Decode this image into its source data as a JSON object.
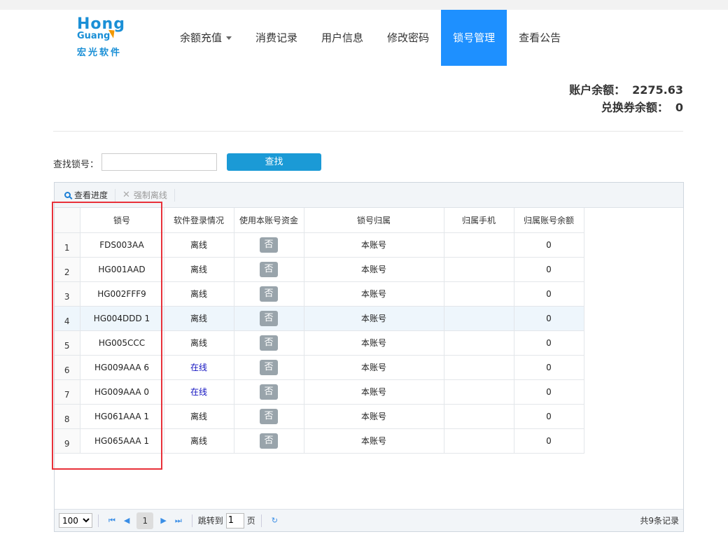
{
  "logo": {
    "en_top": "Hong",
    "en_bottom": "Guang",
    "cn": "宏光软件"
  },
  "nav": {
    "items": [
      {
        "label": "余额充值"
      },
      {
        "label": "消费记录"
      },
      {
        "label": "用户信息"
      },
      {
        "label": "修改密码"
      },
      {
        "label": "锁号管理"
      },
      {
        "label": "查看公告"
      }
    ],
    "active_index": 4
  },
  "balance": {
    "account_label": "账户余额：",
    "account_value": "2275.63",
    "voucher_label": "兑换券余额：",
    "voucher_value": "0"
  },
  "search": {
    "label": "查找锁号：",
    "value": "",
    "button": "查找"
  },
  "toolbar": {
    "view_progress": "查看进度",
    "force_offline": "强制离线"
  },
  "table": {
    "headers": [
      "锁号",
      "软件登录情况",
      "使用本账号资金",
      "锁号归属",
      "归属手机",
      "归属账号余额"
    ],
    "rows": [
      {
        "n": "1",
        "lock": "FDS003AA",
        "login": "离线",
        "fund": "否",
        "owner": "本账号",
        "phone": "",
        "bal": "0"
      },
      {
        "n": "2",
        "lock": "HG001AAD",
        "login": "离线",
        "fund": "否",
        "owner": "本账号",
        "phone": "",
        "bal": "0"
      },
      {
        "n": "3",
        "lock": "HG002FFF9",
        "login": "离线",
        "fund": "否",
        "owner": "本账号",
        "phone": "",
        "bal": "0"
      },
      {
        "n": "4",
        "lock": "HG004DDD 1",
        "login": "离线",
        "fund": "否",
        "owner": "本账号",
        "phone": "",
        "bal": "0"
      },
      {
        "n": "5",
        "lock": "HG005CCC",
        "login": "离线",
        "fund": "否",
        "owner": "本账号",
        "phone": "",
        "bal": "0"
      },
      {
        "n": "6",
        "lock": "HG009AAA 6",
        "login": "在线",
        "fund": "否",
        "owner": "本账号",
        "phone": "",
        "bal": "0"
      },
      {
        "n": "7",
        "lock": "HG009AAA 0",
        "login": "在线",
        "fund": "否",
        "owner": "本账号",
        "phone": "",
        "bal": "0"
      },
      {
        "n": "8",
        "lock": "HG061AAA 1",
        "login": "离线",
        "fund": "否",
        "owner": "本账号",
        "phone": "",
        "bal": "0"
      },
      {
        "n": "9",
        "lock": "HG065AAA 1",
        "login": "离线",
        "fund": "否",
        "owner": "本账号",
        "phone": "",
        "bal": "0"
      }
    ],
    "highlighted_row": 4
  },
  "pager": {
    "page_size": "100",
    "current_page": "1",
    "jump_label": "跳转到",
    "jump_value": "1",
    "page_unit": "页",
    "total": "共9条记录"
  },
  "colors": {
    "accent": "#1e90ff",
    "button": "#1b9ad6",
    "annotation": "#e8313a"
  }
}
